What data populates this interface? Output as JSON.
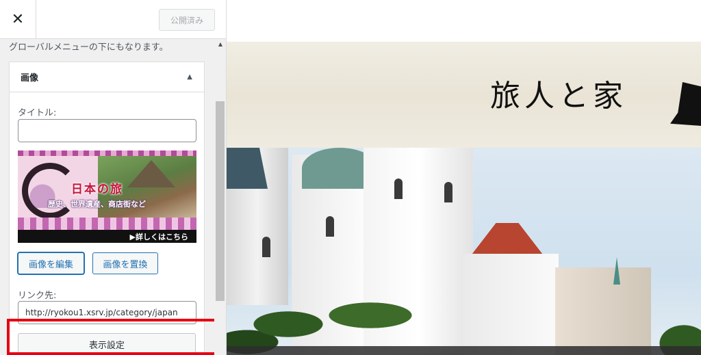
{
  "topbar": {
    "close_glyph": "✕",
    "publish_label": "公開済み"
  },
  "panel": {
    "description": "グローバルメニューの下にもなります。",
    "section_title": "画像",
    "section_arrow": "▲",
    "title_label": "タイトル:",
    "title_value": "",
    "banner": {
      "title": "日本の旅",
      "subtitle": "歴史、世界遺産、商店街など",
      "link_text": "▶詳しくはこちら"
    },
    "edit_image_label": "画像を編集",
    "replace_image_label": "画像を置換",
    "link_label": "リンク先:",
    "link_value": "http://ryokou1.xsrv.jp/category/japan",
    "display_settings_label": "表示設定",
    "scroll_up_glyph": "▲"
  },
  "preview": {
    "site_title": "旅人と家"
  },
  "colors": {
    "highlight": "#e60012",
    "accent": "#2271b1"
  },
  "icons": {
    "close": "close-icon",
    "collapse": "triangle-up-icon",
    "traveler": "traveler-silhouette-icon"
  }
}
